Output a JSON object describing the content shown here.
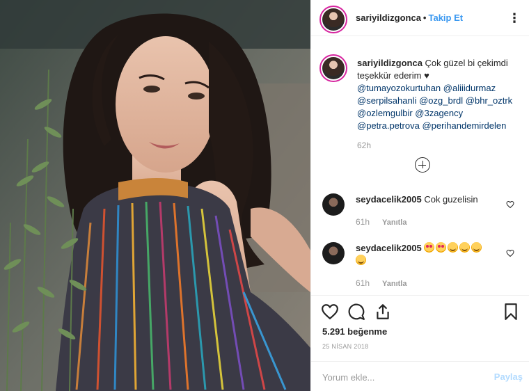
{
  "header": {
    "username": "sariyildizgonca",
    "separator": "•",
    "follow_label": "Takip Et",
    "more_label": "⋮"
  },
  "caption": {
    "username": "sariyildizgonca",
    "text": "Çok güzel bi çekimdi teşekkür ederim",
    "heart": "♥",
    "mentions": [
      "@tumayozokurtuhan",
      "@aliiidurmaz",
      "@serpilsahanli",
      "@ozg_brdl",
      "@bhr_oztrk",
      "@ozlemgulbir",
      "@3zagency",
      "@petra.petrova",
      "@perihandemirdelen"
    ],
    "time": "62h"
  },
  "comments": [
    {
      "username": "seydacelik2005",
      "text": "Cok guzelisin",
      "time": "61h",
      "reply_label": "Yanıtla"
    },
    {
      "username": "seydacelik2005",
      "emojis": [
        "love",
        "love",
        "smile",
        "smile",
        "smile",
        "smile"
      ],
      "time": "61h",
      "reply_label": "Yanıtla"
    }
  ],
  "actions": {
    "likes": "5.291 beğenme",
    "date": "25 NİSAN 2018"
  },
  "comment_box": {
    "placeholder": "Yorum ekle...",
    "share_label": "Paylaş"
  },
  "colors": {
    "link": "#3897f0",
    "mention": "#003569",
    "muted": "#999999",
    "share_disabled": "#b3dbff"
  }
}
